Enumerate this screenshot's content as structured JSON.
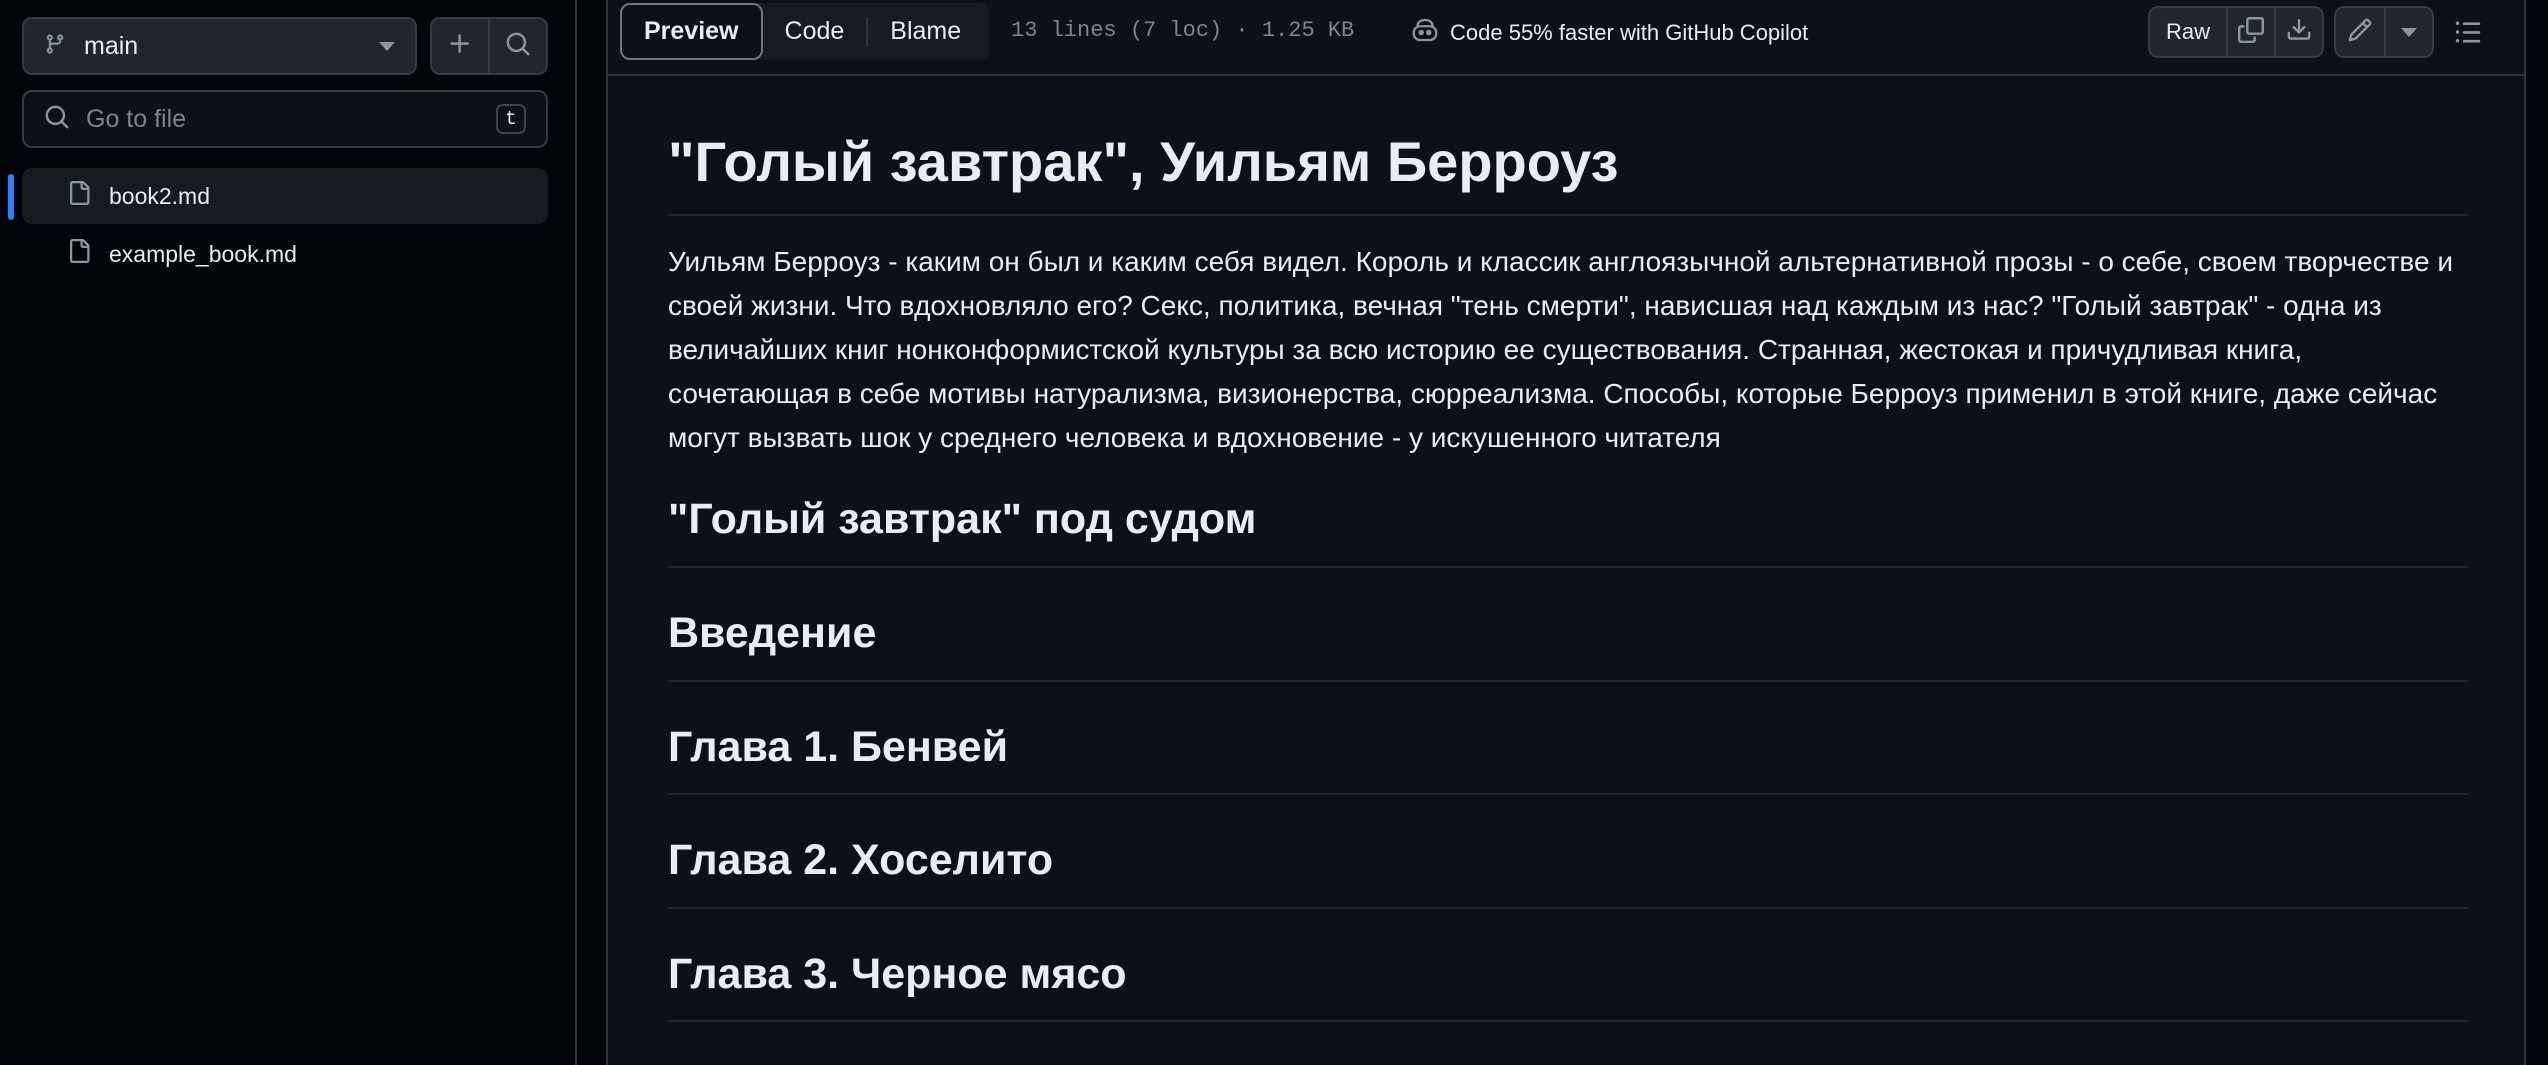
{
  "sidebar": {
    "branch": "main",
    "search_placeholder": "Go to file",
    "search_shortcut": "t",
    "files": [
      {
        "name": "book2.md",
        "active": true
      },
      {
        "name": "example_book.md",
        "active": false
      }
    ]
  },
  "toolbar": {
    "tabs": [
      "Preview",
      "Code",
      "Blame"
    ],
    "selected_tab": "Preview",
    "file_meta": "13 lines (7 loc) · 1.25 KB",
    "copilot_text": "Code 55% faster with GitHub Copilot",
    "raw_label": "Raw"
  },
  "markdown": {
    "title": "\"Голый завтрак\", Уильям Берроуз",
    "paragraph": "Уильям Берроуз - каким он был и каким себя видел. Король и классик англоязычной альтернативной прозы - о себе, своем творчестве и своей жизни. Что вдохновляло его? Секс, политика, вечная \"тень смерти\", нависшая над каждым из нас? \"Голый завтрак\" - одна из величайших книг нонконформистской культуры за всю историю ее существования. Странная, жестокая и причудливая книга, сочетающая в себе мотивы натурализма, визионерства, сюрреализма. Способы, которые Берроуз применил в этой книге, даже сейчас могут вызвать шок у среднего человека и вдохновение - у искушенного читателя",
    "headings": [
      "\"Голый завтрак\" под судом",
      "Введение",
      "Глава 1. Бенвей",
      "Глава 2. Хоселито",
      "Глава 3. Черное мясо"
    ]
  },
  "colors": {
    "accent": "#2f81f7",
    "background": "#0d1117",
    "sidebar_background": "#010409",
    "text": "#e6edf3",
    "muted": "#7d8590"
  }
}
